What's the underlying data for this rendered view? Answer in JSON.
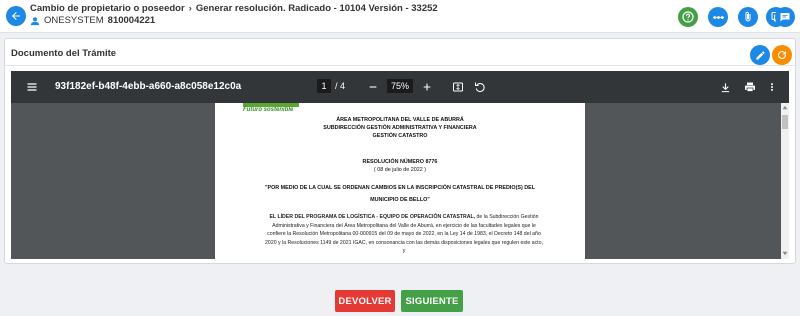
{
  "header": {
    "breadcrumb": [
      "Cambio de propietario o poseedor",
      "Generar resolución. Radicado - 10104 Versión - 33252"
    ],
    "user_name": "ONESYSTEM",
    "user_code": "810004221"
  },
  "actions": {
    "icons": [
      "help-icon",
      "flow-icon",
      "attachment-icon",
      "copy-docs-icon",
      "comment-icon"
    ],
    "colors": [
      "#43a047",
      "#1e88e5",
      "#1e88e5",
      "#1e88e5",
      "#1e88e5"
    ]
  },
  "card": {
    "title": "Documento del Trámite",
    "edit_color": "#1e88e5",
    "refresh_color": "#fb8c00"
  },
  "viewer": {
    "filename": "93f182ef-b48f-4ebb-a660-a8c058e12c0a",
    "page_current": "1",
    "page_total": "/ 4",
    "zoom": "75%"
  },
  "document": {
    "logo_text": "Futuro sostenible",
    "org_line1": "ÁREA METROPOLITANA DEL VALLE DE ABURRÁ",
    "org_line2": "SUBDIRECCIÓN GESTIÓN ADMINISTRATIVA Y FINANCIERA",
    "org_line3": "GESTIÓN CATASTRO",
    "resolution_number": "RESOLUCIÓN NÚMERO 8776",
    "resolution_date": "( 08 de julio de 2022 )",
    "subject_line1": "\"POR MEDIO DE LA CUAL SE ORDENAN CAMBIOS EN LA INSCRIPCIÓN CATASTRAL DE PREDIO(S) DEL",
    "subject_line2": "MUNICIPIO DE BELLO\"",
    "body_bold": "EL LÍDER DEL PROGRAMA DE LOGÍSTICA - EQUIPO DE OPERACIÓN CATASTRAL,",
    "body_line1_rest": " de la Subdirección Gestión",
    "body_line2": "Administrativa y Financiera del Área Metropolitana del Valle de Aburrá, en ejercicio de las facultades legales que le",
    "body_line3": "confiere la Resolución Metropolitana 00-000915 del 09 de mayo de 2022, en la Ley 14 de 1983, el Decreto 148 del año",
    "body_line4": "2020 y la Resoluciones 1149 de 2021 IGAC, en consonancia con las demás disposiciones legales que regulen este acto,",
    "body_line5": "y"
  },
  "footer": {
    "back_label": "DEVOLVER",
    "next_label": "SIGUIENTE",
    "back_color": "#e53935",
    "next_color": "#43a047"
  }
}
